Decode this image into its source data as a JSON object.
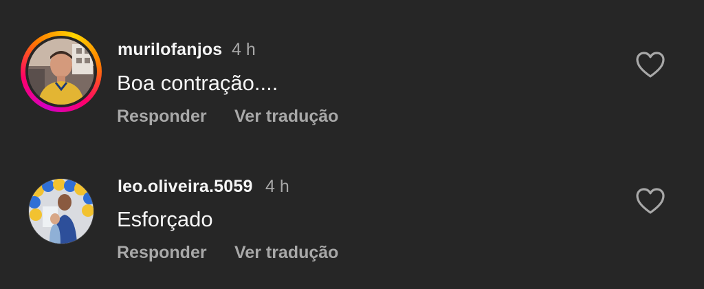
{
  "comments": [
    {
      "username": "murilofanjos",
      "time": "4 h",
      "text": "Boa contração....",
      "reply_label": "Responder",
      "translate_label": "Ver tradução",
      "has_story_ring": true,
      "like_icon": "heart-outline-icon"
    },
    {
      "username": "leo.oliveira.5059",
      "time": "4 h",
      "text": "Esforçado",
      "reply_label": "Responder",
      "translate_label": "Ver tradução",
      "has_story_ring": false,
      "like_icon": "heart-outline-icon"
    }
  ],
  "colors": {
    "background": "#262626",
    "primary_text": "#f5f5f5",
    "secondary_text": "#a8a8a8"
  }
}
